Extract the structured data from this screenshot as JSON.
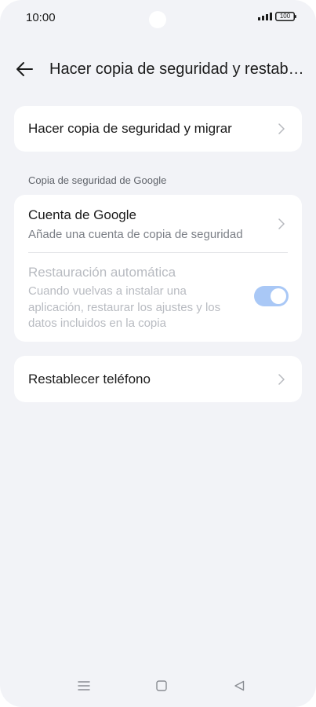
{
  "status_bar": {
    "time": "10:00",
    "battery": "100"
  },
  "header": {
    "back_icon": "arrow-left-icon",
    "title": "Hacer copia de seguridad y restablecer"
  },
  "backup_card": {
    "label": "Hacer copia de seguridad y migrar"
  },
  "google_section": {
    "label": "Copia de seguridad de Google",
    "account": {
      "title": "Cuenta de Google",
      "subtitle": "Añade una cuenta de copia de seguridad"
    },
    "auto_restore": {
      "title": "Restauración automática",
      "description": "Cuando vuelvas a instalar una aplicación, restaurar los ajustes y los datos incluidos en la copia",
      "enabled": true,
      "disabled_state": true
    }
  },
  "reset_card": {
    "label": "Restablecer teléfono"
  },
  "nav": {
    "menu_icon": "menu-icon",
    "home_icon": "home-square-icon",
    "back_icon": "back-triangle-icon"
  },
  "colors": {
    "background": "#f2f3f7",
    "card": "#ffffff",
    "toggle_track": "#a9c8f6",
    "disabled_text": "#b8bbc1"
  }
}
